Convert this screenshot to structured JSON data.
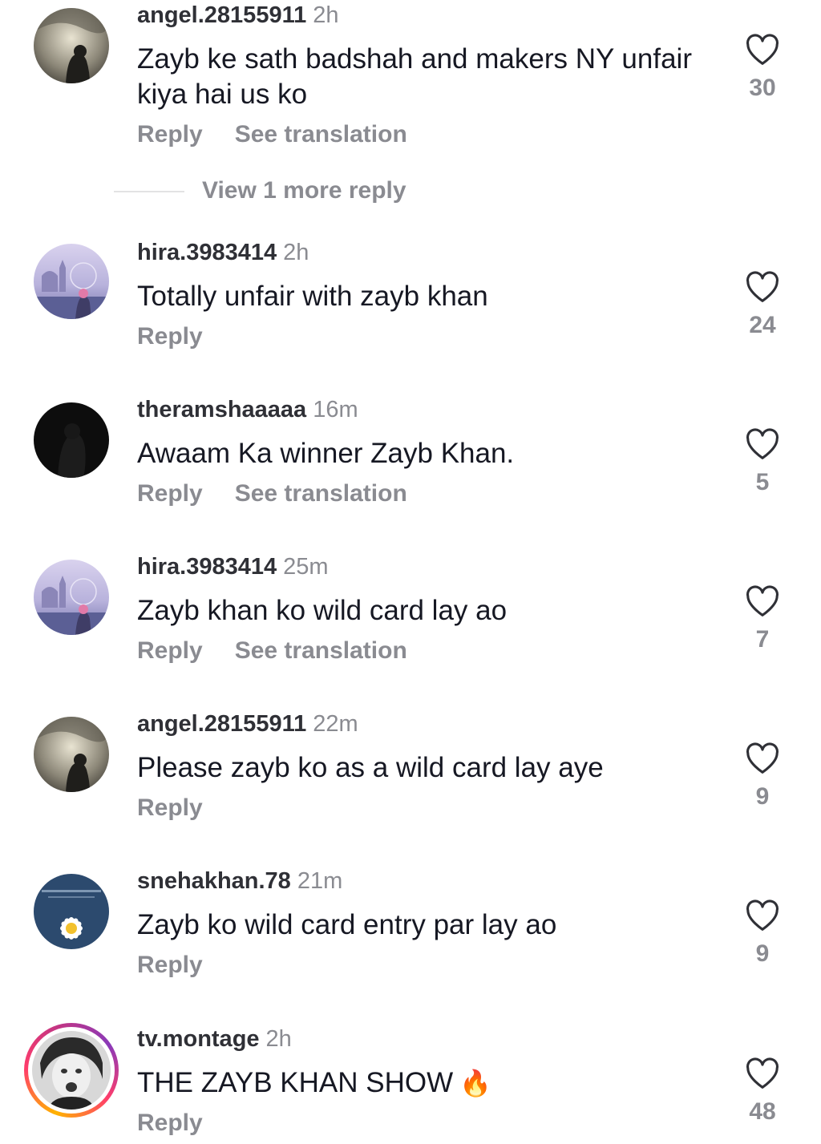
{
  "comments": [
    {
      "username": "angel.28155911",
      "time": "2h",
      "text": "Zayb ke sath badshah and makers NY unfair kiya hai us ko",
      "reply_label": "Reply",
      "translation_label": "See translation",
      "likes": "30"
    },
    {
      "username": "hira.3983414",
      "time": "2h",
      "text": "Totally unfair with zayb khan",
      "reply_label": "Reply",
      "likes": "24"
    },
    {
      "username": "theramshaaaaa",
      "time": "16m",
      "text": "Awaam Ka winner Zayb Khan.",
      "reply_label": "Reply",
      "translation_label": "See translation",
      "likes": "5"
    },
    {
      "username": "hira.3983414",
      "time": "25m",
      "text": "Zayb khan ko wild card lay ao",
      "reply_label": "Reply",
      "translation_label": "See translation",
      "likes": "7"
    },
    {
      "username": "angel.28155911",
      "time": "22m",
      "text": "Please zayb ko as a wild card lay aye",
      "reply_label": "Reply",
      "likes": "9"
    },
    {
      "username": "snehakhan.78",
      "time": "21m",
      "text": "Zayb ko wild card entry par lay ao",
      "reply_label": "Reply",
      "likes": "9"
    },
    {
      "username": "tv.montage",
      "time": "2h",
      "text": "THE ZAYB KHAN SHOW",
      "emoji": "🔥",
      "reply_label": "Reply",
      "likes": "48"
    }
  ],
  "view_more_replies": "View 1 more reply",
  "icons": {
    "like": "heart-outline-icon",
    "fire": "fire-emoji"
  },
  "colors": {
    "text_primary": "#161823",
    "text_secondary": "#8a8b91",
    "username": "#2f3036"
  }
}
